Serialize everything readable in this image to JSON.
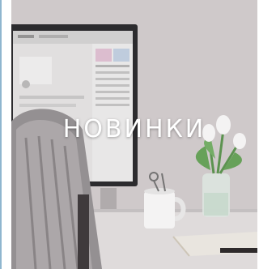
{
  "category": {
    "title": "НОВИНКИ"
  },
  "colors": {
    "accent_rule": "#8fb6cf",
    "title": "#ffffff"
  }
}
